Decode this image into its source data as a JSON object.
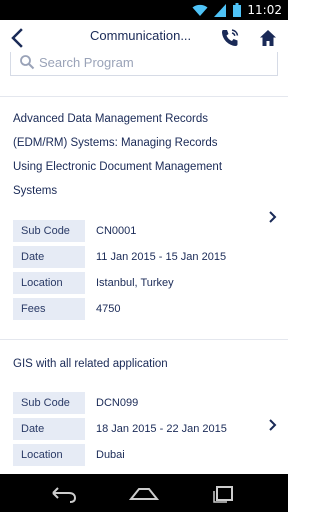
{
  "status_bar": {
    "time": "11:02",
    "icons": [
      "wifi-icon",
      "signal-icon",
      "battery-icon"
    ]
  },
  "app_bar": {
    "title": "Communication...",
    "icons": [
      "back-arrow-icon",
      "phone-icon",
      "home-icon"
    ]
  },
  "search": {
    "placeholder": "Search Program",
    "value": ""
  },
  "programs": [
    {
      "title": "Advanced Data Management Records (EDM/RM) Systems: Managing Records Using Electronic Document Management Systems",
      "title_lines": [
        "Advanced Data Management Records",
        "(EDM/RM) Systems: Managing Records",
        "Using Electronic Document Management",
        "Systems"
      ],
      "details": [
        {
          "label": "Sub Code",
          "value": "CN0001"
        },
        {
          "label": "Date",
          "value": "11 Jan 2015 - 15 Jan 2015"
        },
        {
          "label": "Location",
          "value": "Istanbul, Turkey"
        },
        {
          "label": "Fees",
          "value": "4750"
        }
      ]
    },
    {
      "title": "GIS with all related application",
      "title_lines": [
        "GIS with all related application"
      ],
      "details": [
        {
          "label": "Sub Code",
          "value": "DCN099"
        },
        {
          "label": "Date",
          "value": "18 Jan 2015 - 22 Jan 2015"
        },
        {
          "label": "Location",
          "value": "Dubai"
        }
      ]
    }
  ],
  "colors": {
    "primary": "#1a2a57",
    "label_bg": "#e6ebf5",
    "status_icon": "#4fc3f7"
  },
  "nav_bar": {
    "icons": [
      "back-nav-icon",
      "home-nav-icon",
      "recents-nav-icon"
    ]
  }
}
